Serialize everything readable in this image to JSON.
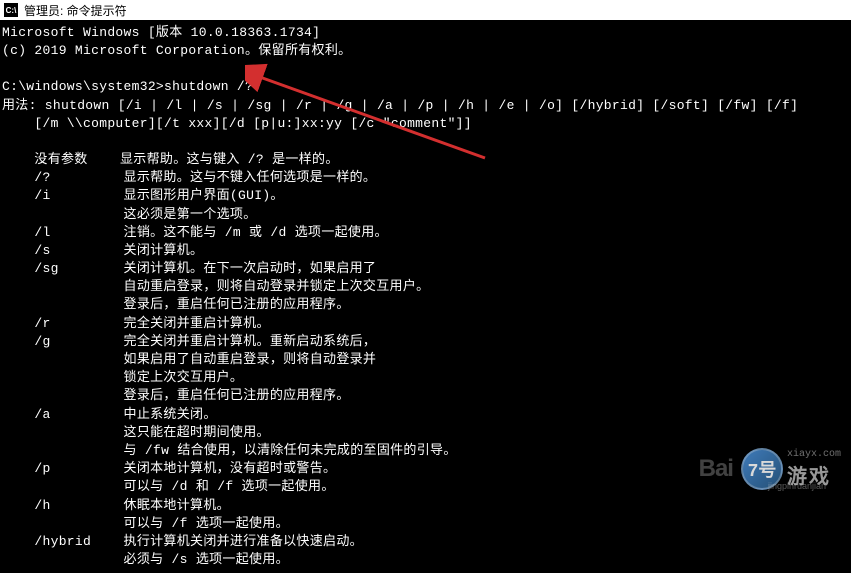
{
  "titlebar": {
    "icon_label": "C:\\",
    "title": "管理员: 命令提示符"
  },
  "terminal": {
    "lines": [
      "Microsoft Windows [版本 10.0.18363.1734]",
      "(c) 2019 Microsoft Corporation。保留所有权利。",
      "",
      "C:\\windows\\system32>shutdown /?",
      "用法: shutdown [/i | /l | /s | /sg | /r | /g | /a | /p | /h | /e | /o] [/hybrid] [/soft] [/fw] [/f]",
      "    [/m \\\\computer][/t xxx][/d [p|u:]xx:yy [/c \"comment\"]]",
      "",
      "    没有参数    显示帮助。这与键入 /? 是一样的。",
      "    /?         显示帮助。这与不键入任何选项是一样的。",
      "    /i         显示图形用户界面(GUI)。",
      "               这必须是第一个选项。",
      "    /l         注销。这不能与 /m 或 /d 选项一起使用。",
      "    /s         关闭计算机。",
      "    /sg        关闭计算机。在下一次启动时，如果启用了",
      "               自动重启登录，则将自动登录并锁定上次交互用户。",
      "               登录后，重启任何已注册的应用程序。",
      "    /r         完全关闭并重启计算机。",
      "    /g         完全关闭并重启计算机。重新启动系统后，",
      "               如果启用了自动重启登录，则将自动登录并",
      "               锁定上次交互用户。",
      "               登录后，重启任何已注册的应用程序。",
      "    /a         中止系统关闭。",
      "               这只能在超时期间使用。",
      "               与 /fw 结合使用，以清除任何未完成的至固件的引导。",
      "    /p         关闭本地计算机，没有超时或警告。",
      "               可以与 /d 和 /f 选项一起使用。",
      "    /h         休眠本地计算机。",
      "               可以与 /f 选项一起使用。",
      "    /hybrid    执行计算机关闭并进行准备以快速启动。",
      "               必须与 /s 选项一起使用。"
    ]
  },
  "watermark": {
    "baidu": "Bai",
    "badge_text": "7号",
    "badge_url": "xiayx.com",
    "main_text": "游戏",
    "sub_text": "jingpinruanjian"
  }
}
